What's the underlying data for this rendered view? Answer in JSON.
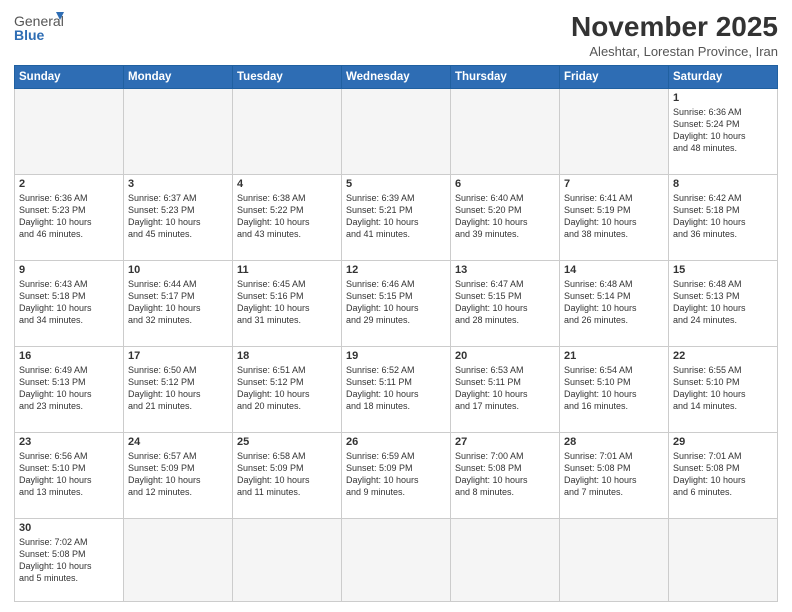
{
  "header": {
    "logo_general": "General",
    "logo_blue": "Blue",
    "month_title": "November 2025",
    "subtitle": "Aleshtar, Lorestan Province, Iran"
  },
  "weekdays": [
    "Sunday",
    "Monday",
    "Tuesday",
    "Wednesday",
    "Thursday",
    "Friday",
    "Saturday"
  ],
  "weeks": [
    [
      {
        "day": "",
        "info": ""
      },
      {
        "day": "",
        "info": ""
      },
      {
        "day": "",
        "info": ""
      },
      {
        "day": "",
        "info": ""
      },
      {
        "day": "",
        "info": ""
      },
      {
        "day": "",
        "info": ""
      },
      {
        "day": "1",
        "info": "Sunrise: 6:36 AM\nSunset: 5:24 PM\nDaylight: 10 hours\nand 48 minutes."
      }
    ],
    [
      {
        "day": "2",
        "info": "Sunrise: 6:36 AM\nSunset: 5:23 PM\nDaylight: 10 hours\nand 46 minutes."
      },
      {
        "day": "3",
        "info": "Sunrise: 6:37 AM\nSunset: 5:23 PM\nDaylight: 10 hours\nand 45 minutes."
      },
      {
        "day": "4",
        "info": "Sunrise: 6:38 AM\nSunset: 5:22 PM\nDaylight: 10 hours\nand 43 minutes."
      },
      {
        "day": "5",
        "info": "Sunrise: 6:39 AM\nSunset: 5:21 PM\nDaylight: 10 hours\nand 41 minutes."
      },
      {
        "day": "6",
        "info": "Sunrise: 6:40 AM\nSunset: 5:20 PM\nDaylight: 10 hours\nand 39 minutes."
      },
      {
        "day": "7",
        "info": "Sunrise: 6:41 AM\nSunset: 5:19 PM\nDaylight: 10 hours\nand 38 minutes."
      },
      {
        "day": "8",
        "info": "Sunrise: 6:42 AM\nSunset: 5:18 PM\nDaylight: 10 hours\nand 36 minutes."
      }
    ],
    [
      {
        "day": "9",
        "info": "Sunrise: 6:43 AM\nSunset: 5:18 PM\nDaylight: 10 hours\nand 34 minutes."
      },
      {
        "day": "10",
        "info": "Sunrise: 6:44 AM\nSunset: 5:17 PM\nDaylight: 10 hours\nand 32 minutes."
      },
      {
        "day": "11",
        "info": "Sunrise: 6:45 AM\nSunset: 5:16 PM\nDaylight: 10 hours\nand 31 minutes."
      },
      {
        "day": "12",
        "info": "Sunrise: 6:46 AM\nSunset: 5:15 PM\nDaylight: 10 hours\nand 29 minutes."
      },
      {
        "day": "13",
        "info": "Sunrise: 6:47 AM\nSunset: 5:15 PM\nDaylight: 10 hours\nand 28 minutes."
      },
      {
        "day": "14",
        "info": "Sunrise: 6:48 AM\nSunset: 5:14 PM\nDaylight: 10 hours\nand 26 minutes."
      },
      {
        "day": "15",
        "info": "Sunrise: 6:48 AM\nSunset: 5:13 PM\nDaylight: 10 hours\nand 24 minutes."
      }
    ],
    [
      {
        "day": "16",
        "info": "Sunrise: 6:49 AM\nSunset: 5:13 PM\nDaylight: 10 hours\nand 23 minutes."
      },
      {
        "day": "17",
        "info": "Sunrise: 6:50 AM\nSunset: 5:12 PM\nDaylight: 10 hours\nand 21 minutes."
      },
      {
        "day": "18",
        "info": "Sunrise: 6:51 AM\nSunset: 5:12 PM\nDaylight: 10 hours\nand 20 minutes."
      },
      {
        "day": "19",
        "info": "Sunrise: 6:52 AM\nSunset: 5:11 PM\nDaylight: 10 hours\nand 18 minutes."
      },
      {
        "day": "20",
        "info": "Sunrise: 6:53 AM\nSunset: 5:11 PM\nDaylight: 10 hours\nand 17 minutes."
      },
      {
        "day": "21",
        "info": "Sunrise: 6:54 AM\nSunset: 5:10 PM\nDaylight: 10 hours\nand 16 minutes."
      },
      {
        "day": "22",
        "info": "Sunrise: 6:55 AM\nSunset: 5:10 PM\nDaylight: 10 hours\nand 14 minutes."
      }
    ],
    [
      {
        "day": "23",
        "info": "Sunrise: 6:56 AM\nSunset: 5:10 PM\nDaylight: 10 hours\nand 13 minutes."
      },
      {
        "day": "24",
        "info": "Sunrise: 6:57 AM\nSunset: 5:09 PM\nDaylight: 10 hours\nand 12 minutes."
      },
      {
        "day": "25",
        "info": "Sunrise: 6:58 AM\nSunset: 5:09 PM\nDaylight: 10 hours\nand 11 minutes."
      },
      {
        "day": "26",
        "info": "Sunrise: 6:59 AM\nSunset: 5:09 PM\nDaylight: 10 hours\nand 9 minutes."
      },
      {
        "day": "27",
        "info": "Sunrise: 7:00 AM\nSunset: 5:08 PM\nDaylight: 10 hours\nand 8 minutes."
      },
      {
        "day": "28",
        "info": "Sunrise: 7:01 AM\nSunset: 5:08 PM\nDaylight: 10 hours\nand 7 minutes."
      },
      {
        "day": "29",
        "info": "Sunrise: 7:01 AM\nSunset: 5:08 PM\nDaylight: 10 hours\nand 6 minutes."
      }
    ],
    [
      {
        "day": "30",
        "info": "Sunrise: 7:02 AM\nSunset: 5:08 PM\nDaylight: 10 hours\nand 5 minutes."
      },
      {
        "day": "",
        "info": ""
      },
      {
        "day": "",
        "info": ""
      },
      {
        "day": "",
        "info": ""
      },
      {
        "day": "",
        "info": ""
      },
      {
        "day": "",
        "info": ""
      },
      {
        "day": "",
        "info": ""
      }
    ]
  ]
}
